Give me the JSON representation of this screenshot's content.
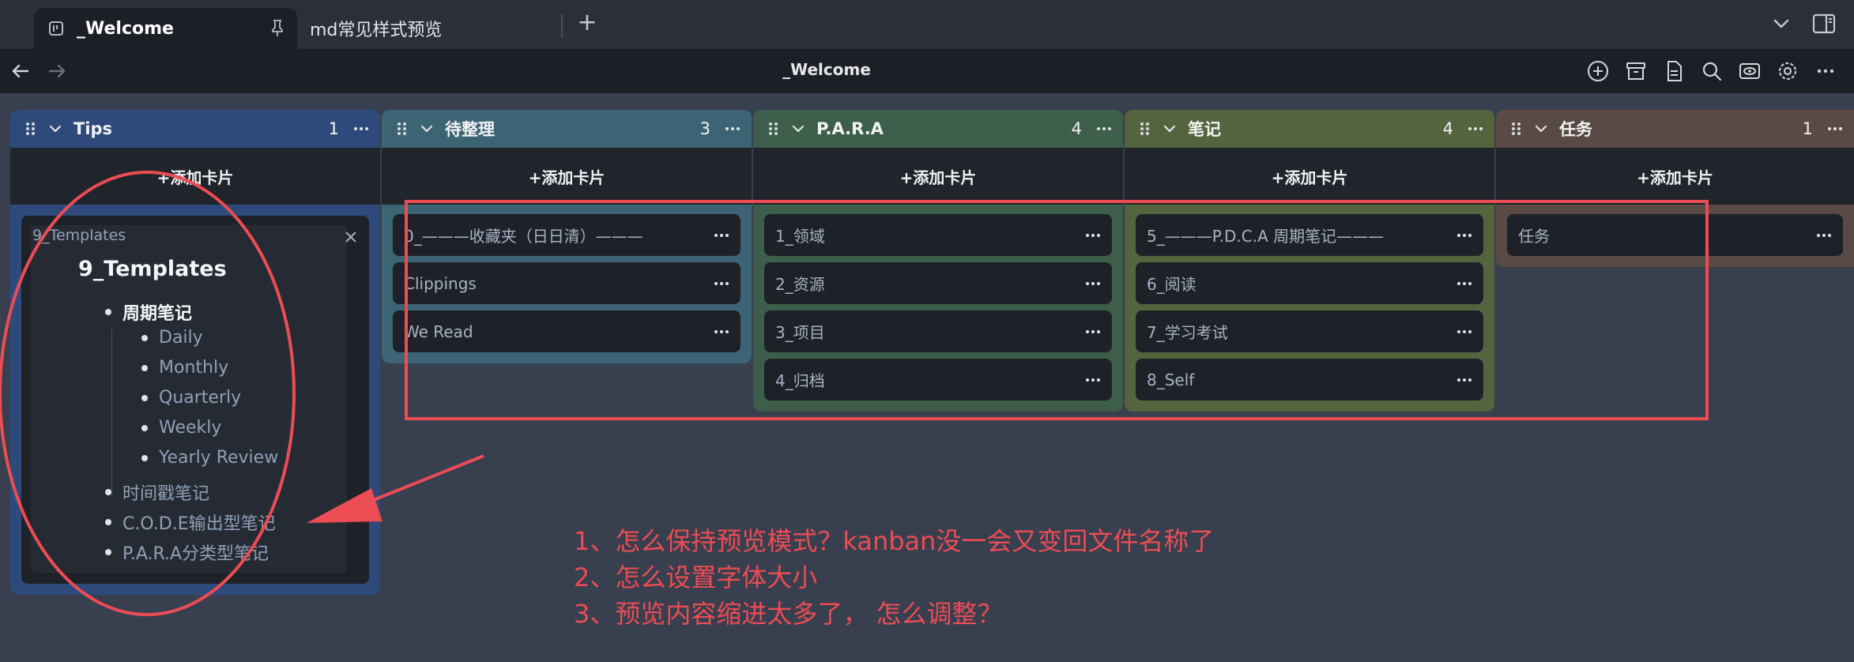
{
  "tabs": [
    {
      "label": "_Welcome",
      "active": true,
      "pinned": true
    },
    {
      "label": "md常见样式预览",
      "active": false
    }
  ],
  "nav": {
    "title": "_Welcome"
  },
  "add_card_label": "+添加卡片",
  "lanes": [
    {
      "title": "Tips",
      "count": "1",
      "color": "#2e4a7a"
    },
    {
      "title": "待整理",
      "count": "3",
      "color": "#3d6474",
      "cards": [
        "0_———收藏夹（日日清）———",
        "Clippings",
        "We Read"
      ]
    },
    {
      "title": "P.A.R.A",
      "count": "4",
      "color": "#3d5e4a",
      "cards": [
        "1_领域",
        "2_资源",
        "3_项目",
        "4_归档"
      ]
    },
    {
      "title": "笔记",
      "count": "4",
      "color": "#55633f",
      "cards": [
        "5_———P.D.C.A 周期笔记———",
        "6_阅读",
        "7_学习考试",
        "8_Self"
      ]
    },
    {
      "title": "任务",
      "count": "1",
      "color": "#5a4a45",
      "cards": [
        "任务"
      ]
    }
  ],
  "tips_card": {
    "label": "9_Templates",
    "preview_title": "9_Templates",
    "items": [
      {
        "text": "周期笔记",
        "level": 1,
        "strong": true
      },
      {
        "text": "Daily",
        "level": 2
      },
      {
        "text": "Monthly",
        "level": 2
      },
      {
        "text": "Quarterly",
        "level": 2
      },
      {
        "text": "Weekly",
        "level": 2
      },
      {
        "text": "Yearly Review",
        "level": 2
      },
      {
        "text": "时间戳笔记",
        "level": 1
      },
      {
        "text": "C.O.D.E输出型笔记",
        "level": 1
      },
      {
        "text": "P.A.R.A分类型笔记",
        "level": 1
      }
    ]
  },
  "annotations": {
    "color": "#ec4c54",
    "notes": [
      "1、怎么保持预览模式？kanban没一会又变回文件名称了",
      "2、怎么设置字体大小",
      "3、预览内容缩进太多了， 怎么调整？"
    ]
  }
}
